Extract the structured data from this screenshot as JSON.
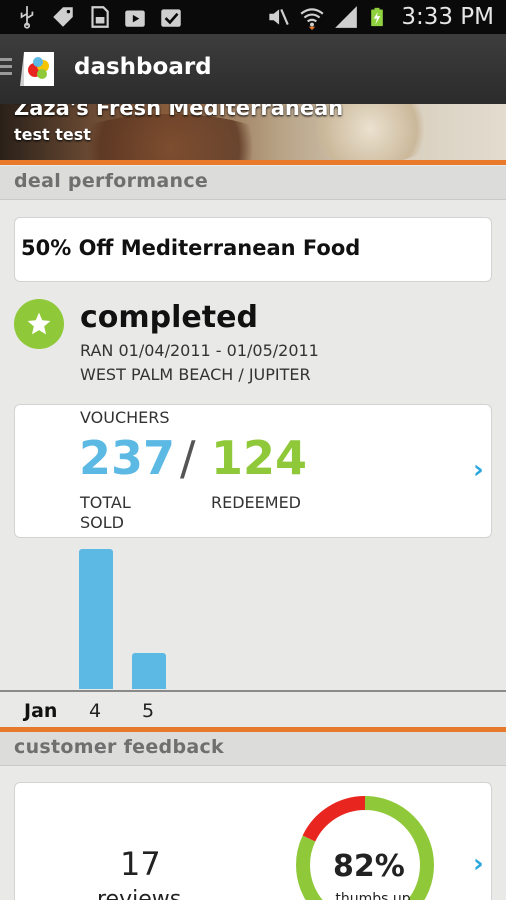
{
  "statusbar": {
    "time": "3:33 PM",
    "left_icons": [
      "usb-icon",
      "tag-icon",
      "sd-card-icon",
      "play-store-icon",
      "checkbox-icon"
    ],
    "right_icons": [
      "mute-icon",
      "wifi-icon",
      "signal-icon",
      "battery-charging-icon"
    ]
  },
  "actionbar": {
    "title": "dashboard"
  },
  "hero": {
    "business_name": "Zaza's Fresh Mediterranean",
    "subtitle": "test test"
  },
  "deal_performance": {
    "header": "deal performance",
    "deal_title": "50% Off Mediterranean Food",
    "status": "completed",
    "ran": "RAN 01/04/2011 - 01/05/2011",
    "location": "WEST PALM BEACH / JUPITER",
    "vouchers_label": "VOUCHERS",
    "total_sold": "237",
    "separator": "/",
    "redeemed": "124",
    "total_sold_label": "TOTAL SOLD",
    "redeemed_label": "REDEEMED",
    "chevron": "›"
  },
  "chart_data": {
    "type": "bar",
    "categories": [
      "4",
      "5"
    ],
    "category_group": "Jan",
    "values": [
      100,
      26
    ],
    "bar_color": "#5cb9e4",
    "title": "",
    "xlabel": "",
    "ylabel": ""
  },
  "customer_feedback": {
    "header": "customer feedback",
    "reviews_count": "17",
    "reviews_label": "reviews",
    "thumbs_up_percent": "82%",
    "thumbs_up_fraction": 0.82,
    "thumbs_up_label": "thumbs up",
    "chevron": "›"
  },
  "colors": {
    "accent_orange": "#e8782a",
    "sold_blue": "#5cb9e4",
    "redeemed_green": "#8fc93a",
    "negative_red": "#e8261f",
    "link_blue": "#2aa7dc"
  }
}
